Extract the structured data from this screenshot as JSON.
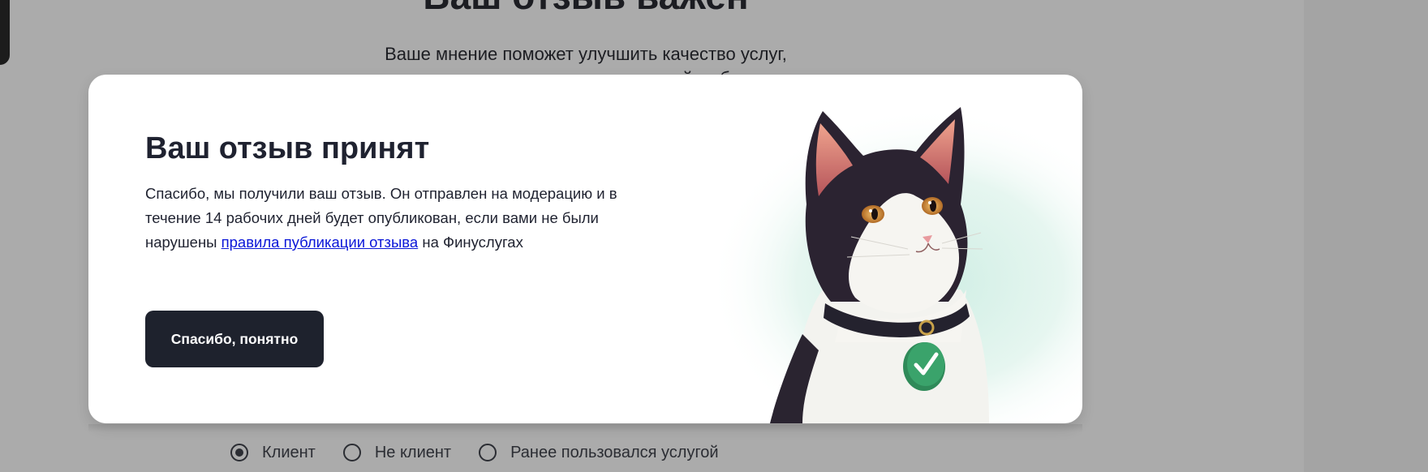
{
  "background": {
    "heading": "Ваш отзыв важен",
    "subtitle_line1": "Ваше мнение поможет улучшить качество услуг,",
    "subtitle_line2": "а другим — сделать осознанный выбор",
    "radio_options": [
      {
        "label": "Клиент",
        "checked": true
      },
      {
        "label": "Не клиент",
        "checked": false
      },
      {
        "label": "Ранее пользовался услугой",
        "checked": false
      }
    ]
  },
  "modal": {
    "title": "Ваш отзыв принят",
    "text_before_link": "Спасибо, мы получили ваш отзыв. Он отправлен на модерацию и в течение 14 рабочих дней будет опубликован, если вами не были нарушены ",
    "link_text": "правила публикации отзыва",
    "text_after_link": " на Финуслугах",
    "button_label": "Спасибо, понятно",
    "illustration": "cat-with-checkmark-tag",
    "accent_color": "#1e222d",
    "link_color": "#0a16d8",
    "tag_color": "#3aa36b"
  }
}
